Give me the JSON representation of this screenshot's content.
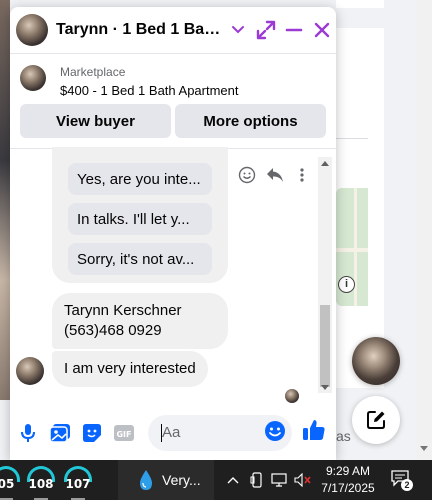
{
  "chat": {
    "title": "Tarynn · 1 Bed 1 Bath A...",
    "marketplace_label": "Marketplace",
    "listing": "$400 - 1 Bed 1 Bath Apartment",
    "buttons": {
      "view_buyer": "View buyer",
      "more_options": "More options"
    },
    "quick_replies": [
      "Yes, are you inte...",
      "In talks. I'll let y...",
      "Sorry, it's not av..."
    ],
    "messages": [
      {
        "text": "Tarynn Kerschner\n(563)468 0929"
      },
      {
        "text": "I am very interested"
      }
    ],
    "composer": {
      "placeholder": "Aa"
    },
    "accent_color": "#9b3bd4",
    "messenger_blue": "#0866ff"
  },
  "background": {
    "snippet": "as"
  },
  "taskbar": {
    "pinned": [
      {
        "label": "05"
      },
      {
        "label": "108"
      },
      {
        "label": "107"
      }
    ],
    "weather": "Very...",
    "time": "9:29 AM",
    "date": "7/17/2025",
    "notification_count": "2"
  }
}
